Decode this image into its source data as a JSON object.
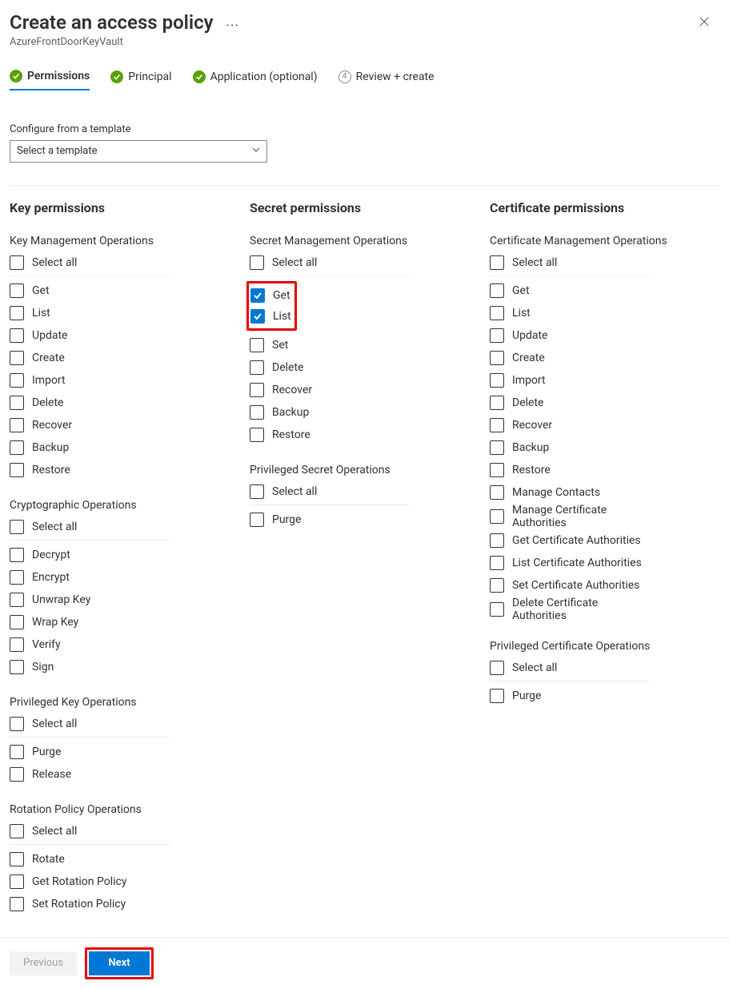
{
  "header": {
    "title": "Create an access policy",
    "subtitle": "AzureFrontDoorKeyVault"
  },
  "steps": [
    {
      "kind": "done",
      "label": "Permissions",
      "active": true
    },
    {
      "kind": "done",
      "label": "Principal",
      "active": false
    },
    {
      "kind": "done",
      "label": "Application (optional)",
      "active": false
    },
    {
      "kind": "pending",
      "num": "4",
      "label": "Review + create",
      "active": false
    }
  ],
  "template": {
    "label": "Configure from a template",
    "placeholder": "Select a template"
  },
  "labels": {
    "select_all": "Select all"
  },
  "columns": {
    "key": {
      "title": "Key permissions",
      "groups": [
        {
          "heading": "Key Management Operations",
          "items": [
            {
              "label": "Get",
              "checked": false
            },
            {
              "label": "List",
              "checked": false
            },
            {
              "label": "Update",
              "checked": false
            },
            {
              "label": "Create",
              "checked": false
            },
            {
              "label": "Import",
              "checked": false
            },
            {
              "label": "Delete",
              "checked": false
            },
            {
              "label": "Recover",
              "checked": false
            },
            {
              "label": "Backup",
              "checked": false
            },
            {
              "label": "Restore",
              "checked": false
            }
          ]
        },
        {
          "heading": "Cryptographic Operations",
          "items": [
            {
              "label": "Decrypt",
              "checked": false
            },
            {
              "label": "Encrypt",
              "checked": false
            },
            {
              "label": "Unwrap Key",
              "checked": false
            },
            {
              "label": "Wrap Key",
              "checked": false
            },
            {
              "label": "Verify",
              "checked": false
            },
            {
              "label": "Sign",
              "checked": false
            }
          ]
        },
        {
          "heading": "Privileged Key Operations",
          "items": [
            {
              "label": "Purge",
              "checked": false
            },
            {
              "label": "Release",
              "checked": false
            }
          ]
        },
        {
          "heading": "Rotation Policy Operations",
          "items": [
            {
              "label": "Rotate",
              "checked": false
            },
            {
              "label": "Get Rotation Policy",
              "checked": false
            },
            {
              "label": "Set Rotation Policy",
              "checked": false
            }
          ]
        }
      ]
    },
    "secret": {
      "title": "Secret permissions",
      "groups": [
        {
          "heading": "Secret Management Operations",
          "highlight_indices": [
            0,
            1
          ],
          "items": [
            {
              "label": "Get",
              "checked": true
            },
            {
              "label": "List",
              "checked": true
            },
            {
              "label": "Set",
              "checked": false
            },
            {
              "label": "Delete",
              "checked": false
            },
            {
              "label": "Recover",
              "checked": false
            },
            {
              "label": "Backup",
              "checked": false
            },
            {
              "label": "Restore",
              "checked": false
            }
          ]
        },
        {
          "heading": "Privileged Secret Operations",
          "items": [
            {
              "label": "Purge",
              "checked": false
            }
          ]
        }
      ]
    },
    "certificate": {
      "title": "Certificate permissions",
      "groups": [
        {
          "heading": "Certificate Management Operations",
          "items": [
            {
              "label": "Get",
              "checked": false
            },
            {
              "label": "List",
              "checked": false
            },
            {
              "label": "Update",
              "checked": false
            },
            {
              "label": "Create",
              "checked": false
            },
            {
              "label": "Import",
              "checked": false
            },
            {
              "label": "Delete",
              "checked": false
            },
            {
              "label": "Recover",
              "checked": false
            },
            {
              "label": "Backup",
              "checked": false
            },
            {
              "label": "Restore",
              "checked": false
            },
            {
              "label": "Manage Contacts",
              "checked": false
            },
            {
              "label": "Manage Certificate Authorities",
              "checked": false
            },
            {
              "label": "Get Certificate Authorities",
              "checked": false
            },
            {
              "label": "List Certificate Authorities",
              "checked": false
            },
            {
              "label": "Set Certificate Authorities",
              "checked": false
            },
            {
              "label": "Delete Certificate Authorities",
              "checked": false
            }
          ]
        },
        {
          "heading": "Privileged Certificate Operations",
          "items": [
            {
              "label": "Purge",
              "checked": false
            }
          ]
        }
      ]
    }
  },
  "footer": {
    "previous": "Previous",
    "next": "Next"
  }
}
